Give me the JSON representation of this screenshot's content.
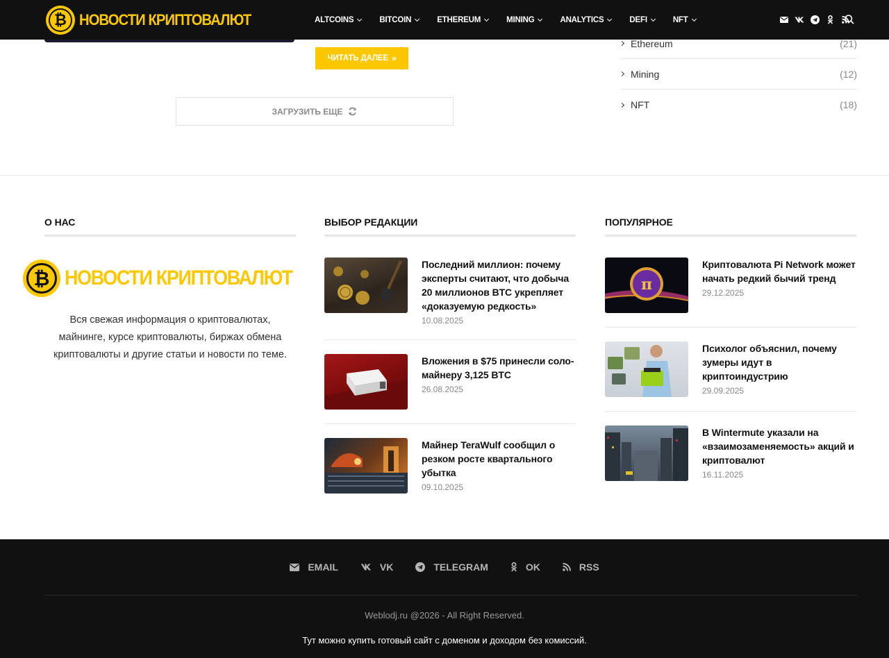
{
  "header": {
    "logo_text": "НОВОСТИ КРИПТОВАЛЮТ",
    "logo_symbol": "₿",
    "nav": [
      {
        "label": "ALTCOINS"
      },
      {
        "label": "BITCOIN"
      },
      {
        "label": "ETHEREUM"
      },
      {
        "label": "MINING"
      },
      {
        "label": "ANALYTICS"
      },
      {
        "label": "DEFI"
      },
      {
        "label": "NFT"
      }
    ],
    "social_icons": [
      "email-icon",
      "vk-icon",
      "telegram-icon",
      "ok-icon",
      "rss-icon"
    ],
    "search_icon": "search-icon"
  },
  "content": {
    "read_more_label": "ЧИТАТЬ ДАЛЕЕ",
    "load_more_label": "ЗАГРУЗИТЬ ЕЩЕ"
  },
  "categories": [
    {
      "name": "Ethereum",
      "count": "(21)"
    },
    {
      "name": "Mining",
      "count": "(12)"
    },
    {
      "name": "NFT",
      "count": "(18)"
    }
  ],
  "widgets": {
    "about": {
      "title": "О НАС",
      "logo_text": "НОВОСТИ КРИПТОВАЛЮТ",
      "text": "Вся свежая информация о криптовалютах, майнинге, курсе криптовалюты, биржах обмена криптовалюты и другие статьи и новости по теме."
    },
    "editors": {
      "title": "ВЫБОР РЕДАКЦИИ",
      "posts": [
        {
          "title": "Последний миллион: почему эксперты считают, что добыча 20 миллионов BTC укрепляет «доказуемую редкость»",
          "date": "10.08.2025"
        },
        {
          "title": "Вложения в $75 принесли соло-майнеру 3,125 BTC",
          "date": "26.08.2025"
        },
        {
          "title": "Майнер TeraWulf сообщил о резком росте квартального убытка",
          "date": "09.10.2025"
        }
      ]
    },
    "popular": {
      "title": "ПОПУЛЯРНОЕ",
      "posts": [
        {
          "title": "Криптовалюта Pi Network может начать редкий бычий тренд",
          "date": "29.12.2025"
        },
        {
          "title": "Психолог объяснил, почему зумеры идут в криптоиндустрию",
          "date": "29.09.2025"
        },
        {
          "title": "В Wintermute указали на «взаимозаменяемость» акций и криптовалют",
          "date": "16.11.2025"
        }
      ]
    }
  },
  "footer": {
    "social": [
      {
        "label": "EMAIL",
        "icon": "email-icon"
      },
      {
        "label": "VK",
        "icon": "vk-icon"
      },
      {
        "label": "TELEGRAM",
        "icon": "telegram-icon"
      },
      {
        "label": "OK",
        "icon": "ok-icon"
      },
      {
        "label": "RSS",
        "icon": "rss-icon"
      }
    ],
    "copyright": "Weblodj.ru @2026 - All Right Reserved.",
    "promo": "Тут можно купить готовый сайт с доменом и доходом без комиссий."
  },
  "colors": {
    "accent": "#fbc800",
    "header_bg": "#111111",
    "footer_bg": "#111111"
  }
}
